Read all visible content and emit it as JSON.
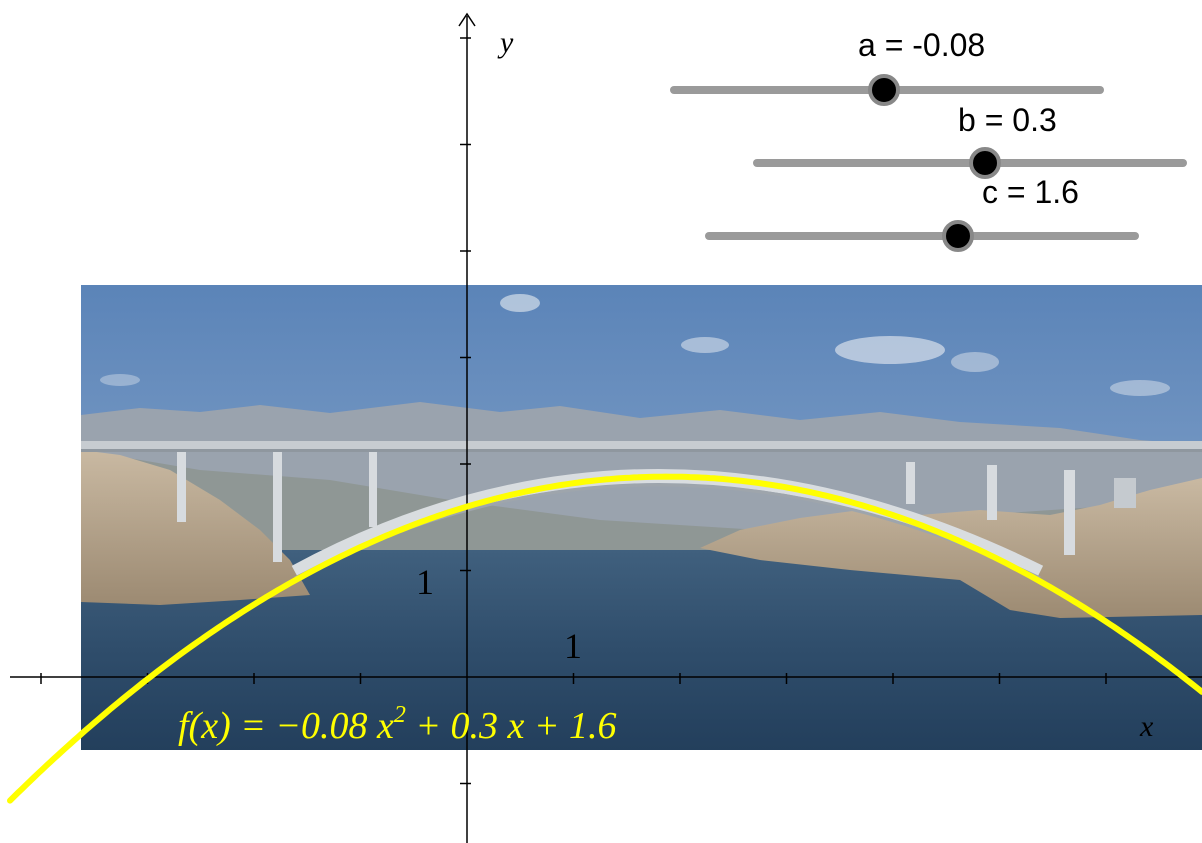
{
  "graph": {
    "axes": {
      "x_label": "x",
      "y_label": "y",
      "x_unit_label": "1",
      "y_unit_label": "1"
    },
    "function": {
      "name": "f",
      "coefficients": {
        "a": -0.08,
        "b": 0.3,
        "c": 1.6
      },
      "label_prefix": "f(x) = −0.08 x",
      "label_exponent": "2",
      "label_suffix": " + 0.3 x + 1.6",
      "color": "#ffff00"
    },
    "background_image": {
      "description_icon": "bridge-photo"
    }
  },
  "sliders": [
    {
      "label": "a = -0.08",
      "value": -0.08
    },
    {
      "label": "b = 0.3",
      "value": 0.3
    },
    {
      "label": "c = 1.6",
      "value": 1.6
    }
  ],
  "colors": {
    "curve": "#ffff00",
    "slider_track": "#9a9a9a",
    "slider_knob": "#000000",
    "axis": "#000000"
  }
}
